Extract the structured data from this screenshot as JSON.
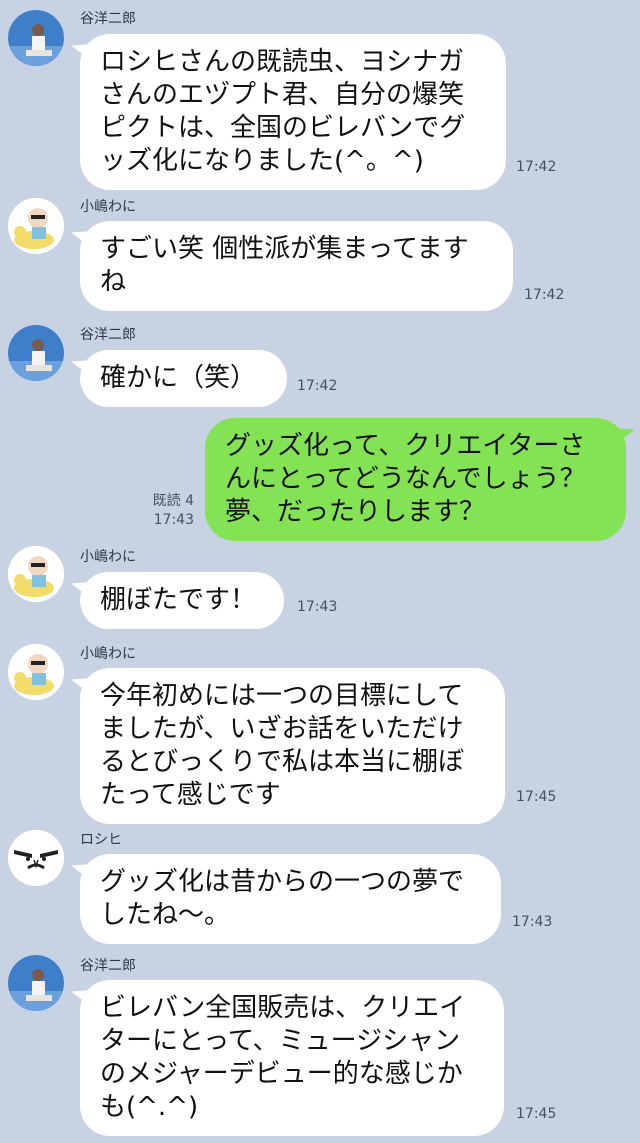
{
  "messages": [
    {
      "sender": "谷洋二郎",
      "avatar": "photo-avatar",
      "text": "ロシヒさんの既読虫、ヨシナガ\nさんのエヅプト君、自分の爆笑\nピクトは、全国のビレバンでグ\nッズ化になりました(^。^)",
      "time": "17:42"
    },
    {
      "sender": "小嶋わに",
      "avatar": "baby-on-duck-avatar",
      "text": "すごい笑 個性派が集まってます\nね",
      "time": "17:42"
    },
    {
      "sender": "谷洋二郎",
      "avatar": "photo-avatar",
      "text": "確かに（笑）",
      "time": "17:42"
    },
    {
      "sender": "",
      "avatar": "",
      "text": "グッズ化って、クリエイターさ\nんにとってどうなんでしょう？\n夢、だったりします？",
      "read": "既読 4",
      "time": "17:43"
    },
    {
      "sender": "小嶋わに",
      "avatar": "baby-on-duck-avatar",
      "text": "棚ぼたです！",
      "time": "17:43"
    },
    {
      "sender": "小嶋わに",
      "avatar": "baby-on-duck-avatar",
      "text": "今年初めには一つの目標にして\nましたが、いざお話をいただけ\nるとびっくりで私は本当に棚ぼ\nたって感じです",
      "time": "17:45"
    },
    {
      "sender": "ロシヒ",
      "avatar": "angry-face-avatar",
      "text": "グッズ化は昔からの一つの夢で\nしたね〜。",
      "time": "17:43"
    },
    {
      "sender": "谷洋二郎",
      "avatar": "photo-avatar",
      "text": "ビレバン全国販売は、クリエイ\nターにとって、ミュージシャン\nのメジャーデビュー的な感じか\nも(^.^)",
      "time": "17:45"
    }
  ],
  "colors": {
    "background": "#c7d2e3",
    "incoming_bubble": "#ffffff",
    "outgoing_bubble": "#84e354"
  }
}
